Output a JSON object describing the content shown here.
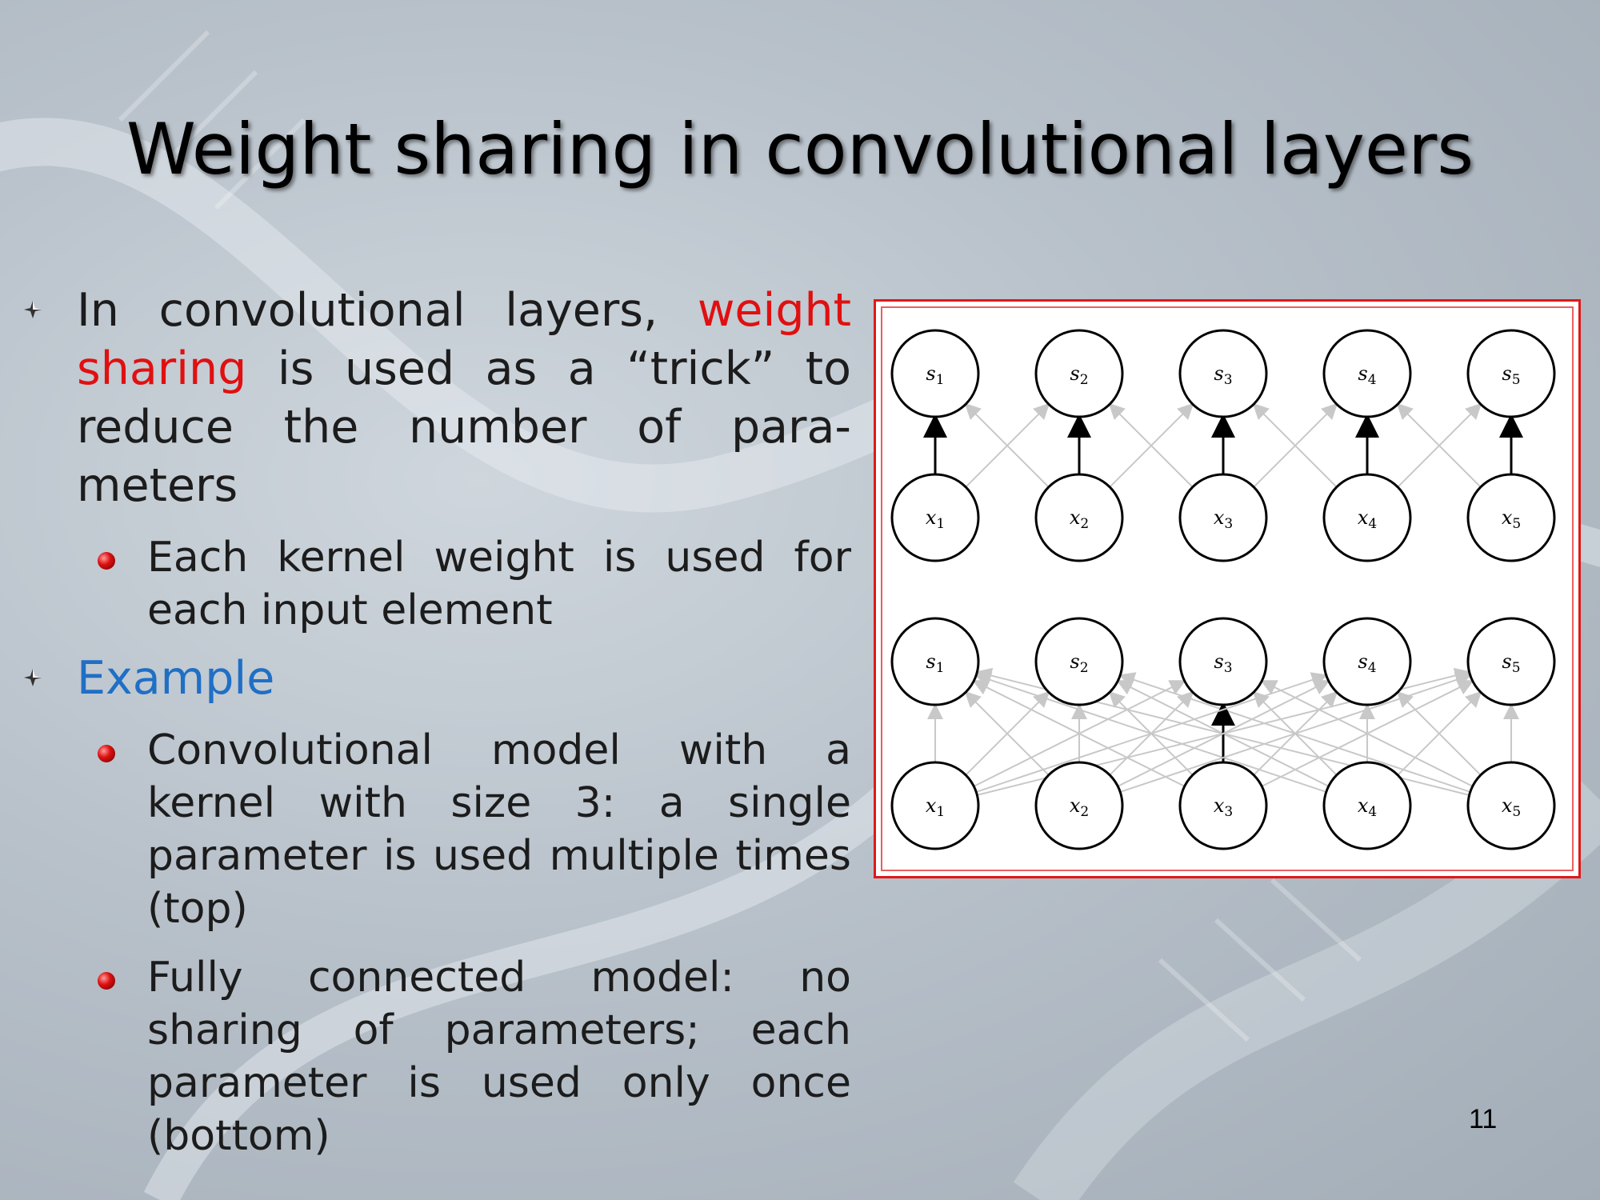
{
  "slide": {
    "title": "Weight sharing in convolutional layers",
    "page_number": "11"
  },
  "bullets": {
    "b1": {
      "pre": "In convolutional layers, ",
      "highlight": "weight sharing",
      "post": " is used as a “trick” to reduce the number of para-meters",
      "sub": [
        "Each kernel weight is used for each input element"
      ]
    },
    "b2": {
      "label": "Example",
      "sub": [
        "Convolutional model with a kernel with size 3: a single parameter is used multiple times (top)",
        "Fully connected model: no sharing of parameters; each parameter is used only once (bottom)"
      ]
    }
  },
  "figure": {
    "top": {
      "outputs": [
        "s1",
        "s2",
        "s3",
        "s4",
        "s5"
      ],
      "inputs": [
        "x1",
        "x2",
        "x3",
        "x4",
        "x5"
      ]
    },
    "bottom": {
      "outputs": [
        "s1",
        "s2",
        "s3",
        "s4",
        "s5"
      ],
      "inputs": [
        "x1",
        "x2",
        "x3",
        "x4",
        "x5"
      ]
    }
  },
  "colors": {
    "highlight_red": "#e01010",
    "highlight_blue": "#1f6fc5",
    "frame_red": "#e01818",
    "edge_strong": "#000000",
    "edge_weak": "#c8c8c8"
  }
}
